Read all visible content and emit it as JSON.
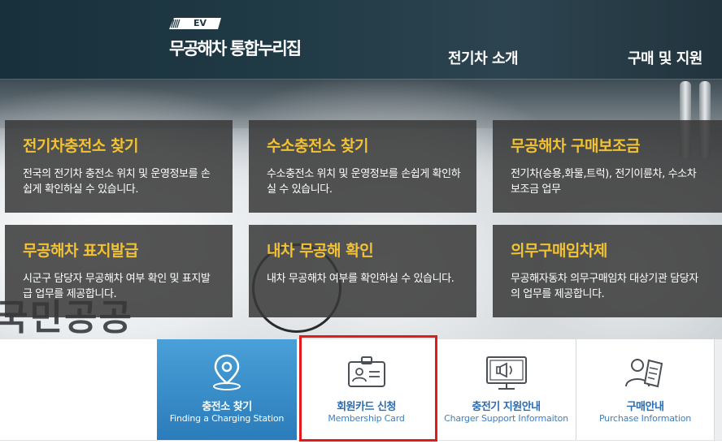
{
  "header": {
    "logo_badge": "EV",
    "logo_slashes": "////",
    "logo_title": "무공해차 통합누리집",
    "nav": [
      {
        "label": "전기차 소개"
      },
      {
        "label": "구매 및 지원"
      }
    ]
  },
  "hero": {
    "background_lettering": "국민공공"
  },
  "tiles": [
    {
      "title": "전기차충전소 찾기",
      "desc": "전국의 전기차 충전소 위치 및 운영정보를 손쉽게 확인하실 수 있습니다."
    },
    {
      "title": "수소충전소 찾기",
      "desc": "수소충전소 위치 및 운영정보를 손쉽게 확인하실 수 있습니다."
    },
    {
      "title": "무공해차 구매보조금",
      "desc": "전기차(승용,화물,트럭), 전기이륜차, 수소차 보조금 업무"
    },
    {
      "title": "무공해차 표지발급",
      "desc": "시군구 담당자 무공해차 여부 확인 및 표지발급 업무를 제공합니다."
    },
    {
      "title": "내차 무공해 확인",
      "desc": "내차 무공해차 여부를 확인하실 수 있습니다."
    },
    {
      "title": "의무구매임차제",
      "desc": "무공해자동차 의무구매임차 대상기관 담당자의 업무를 제공합니다."
    }
  ],
  "quick_menu": [
    {
      "title": "충전소 찾기",
      "subtitle": "Finding a Charging Station",
      "icon": "location-pin-icon",
      "active": true
    },
    {
      "title": "회원카드 신청",
      "subtitle": "Membership Card",
      "icon": "id-card-icon",
      "active": false
    },
    {
      "title": "충전기 지원안내",
      "subtitle": "Charger Support Informaiton",
      "icon": "monitor-megaphone-icon",
      "active": false
    },
    {
      "title": "구매안내",
      "subtitle": "Purchase Information",
      "icon": "user-document-icon",
      "active": false
    }
  ],
  "colors": {
    "tile_title": "#f2c232",
    "tile_bg": "#383838",
    "quick_active_bg": "#2a7cba",
    "quick_text": "#2b6cb0",
    "highlight": "#e11b1b"
  }
}
